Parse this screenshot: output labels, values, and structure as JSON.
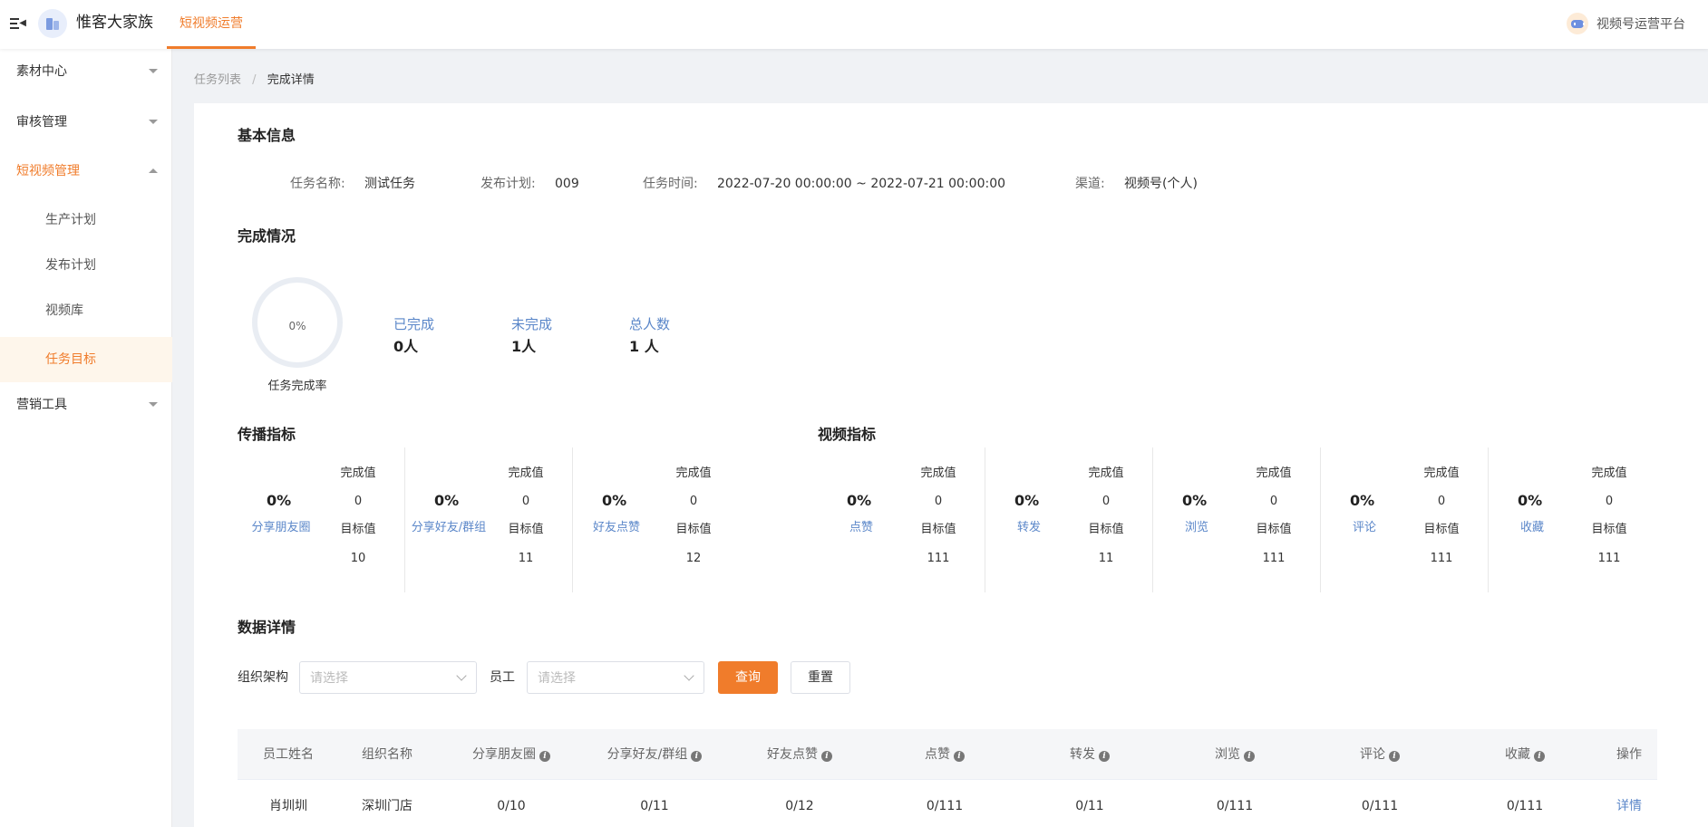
{
  "header": {
    "app_title": "惟客大家族",
    "nav_tab": "短视频运营",
    "platform_label": "视频号运营平台",
    "accent_color": "#f07c2b",
    "icons": {
      "menu": "menu-fold-icon",
      "logo": "building-icon",
      "platform": "robot-icon"
    }
  },
  "sidebar": {
    "groups": [
      {
        "label": "素材中心"
      },
      {
        "label": "审核管理"
      },
      {
        "label": "短视频管理",
        "expanded": true,
        "items": [
          {
            "label": "生产计划"
          },
          {
            "label": "发布计划"
          },
          {
            "label": "视频库"
          },
          {
            "label": "任务目标",
            "active": true
          }
        ]
      },
      {
        "label": "营销工具"
      }
    ]
  },
  "breadcrumb": {
    "parent": "任务列表",
    "separator": "/",
    "current": "完成详情"
  },
  "basic_info": {
    "title": "基本信息",
    "task_name_label": "任务名称:",
    "task_name": "测试任务",
    "plan_label": "发布计划:",
    "plan": "009",
    "time_label": "任务时间:",
    "time": "2022-07-20 00:00:00 ~ 2022-07-21 00:00:00",
    "channel_label": "渠道:",
    "channel": "视频号(个人)"
  },
  "completion": {
    "title": "完成情况",
    "rate": "0%",
    "rate_fraction": 0,
    "rate_label": "任务完成率",
    "stats": [
      {
        "label": "已完成",
        "value": "0人"
      },
      {
        "label": "未完成",
        "value": "1人"
      },
      {
        "label": "总人数",
        "value": "1 人"
      }
    ]
  },
  "metrics": {
    "spread_title": "传播指标",
    "video_title": "视频指标",
    "done_label": "完成值",
    "target_label": "目标值",
    "spread": [
      {
        "name": "分享朋友圈",
        "pct": "0%",
        "done": "0",
        "target": "10"
      },
      {
        "name": "分享好友/群组",
        "pct": "0%",
        "done": "0",
        "target": "11"
      },
      {
        "name": "好友点赞",
        "pct": "0%",
        "done": "0",
        "target": "12"
      }
    ],
    "video": [
      {
        "name": "点赞",
        "pct": "0%",
        "done": "0",
        "target": "111"
      },
      {
        "name": "转发",
        "pct": "0%",
        "done": "0",
        "target": "11"
      },
      {
        "name": "浏览",
        "pct": "0%",
        "done": "0",
        "target": "111"
      },
      {
        "name": "评论",
        "pct": "0%",
        "done": "0",
        "target": "111"
      },
      {
        "name": "收藏",
        "pct": "0%",
        "done": "0",
        "target": "111"
      }
    ]
  },
  "details": {
    "title": "数据详情",
    "org_label": "组织架构",
    "org_placeholder": "请选择",
    "employee_label": "员工",
    "employee_placeholder": "请选择",
    "query_button": "查询",
    "reset_button": "重置",
    "columns": [
      "员工姓名",
      "组织名称",
      "分享朋友圈",
      "分享好友/群组",
      "好友点赞",
      "点赞",
      "转发",
      "浏览",
      "评论",
      "收藏",
      "操作"
    ],
    "info_icon_columns": [
      2,
      3,
      4,
      5,
      6,
      7,
      8,
      9
    ],
    "rows": [
      [
        "肖圳圳",
        "深圳门店",
        "0/10",
        "0/11",
        "0/12",
        "0/111",
        "0/11",
        "0/111",
        "0/111",
        "0/111",
        "详情"
      ]
    ]
  }
}
